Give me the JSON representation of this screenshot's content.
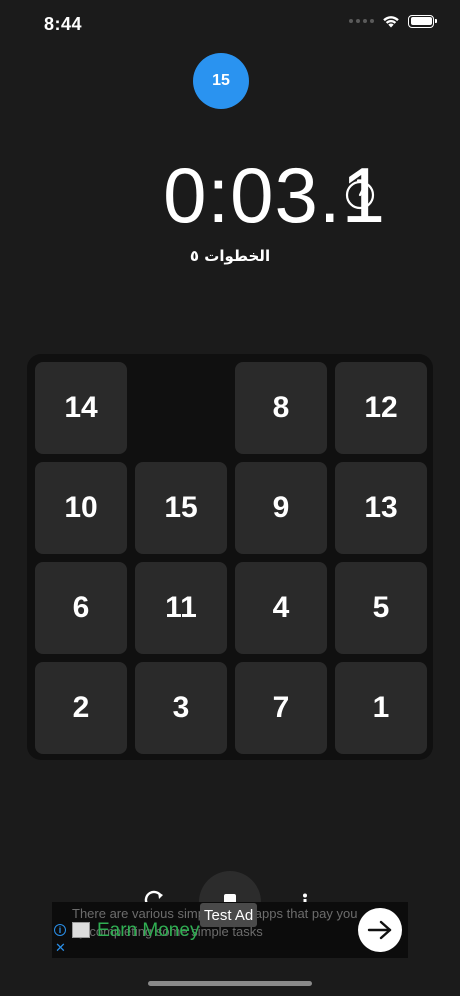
{
  "status_bar": {
    "time": "8:44"
  },
  "level_badge": "15",
  "timer": "0:03.1",
  "moves_label": "الخطوات ٥",
  "board": {
    "size": 4,
    "tiles": [
      [
        "14",
        "",
        "8",
        "12"
      ],
      [
        "10",
        "15",
        "9",
        "13"
      ],
      [
        "6",
        "11",
        "4",
        "5"
      ],
      [
        "2",
        "3",
        "7",
        "1"
      ]
    ]
  },
  "ad": {
    "label": "Test Ad",
    "title": "Earn Money",
    "description": "There are various simple game apps that pay you by completing some simple tasks"
  },
  "colors": {
    "background": "#1b1b1b",
    "tile": "#2a2a2a",
    "board": "#101010",
    "accent": "#2a93f0",
    "ad_title": "#2fae52"
  }
}
